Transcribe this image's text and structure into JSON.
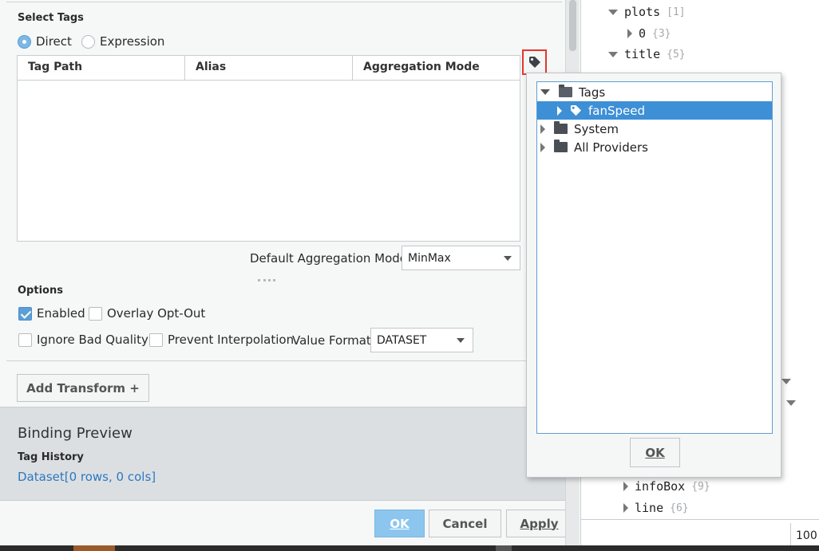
{
  "dialog": {
    "select_tags_label": "Select Tags",
    "source_mode": {
      "direct": "Direct",
      "expression": "Expression",
      "selected": "Direct"
    },
    "table_columns": [
      "Tag Path",
      "Alias",
      "Aggregation Mode"
    ],
    "default_aggregation_label": "Default Aggregation Mode",
    "default_aggregation_value": "MinMax",
    "options_label": "Options",
    "options": {
      "enabled": {
        "label": "Enabled",
        "checked": true
      },
      "overlay_opt_out": {
        "label": "Overlay Opt-Out",
        "checked": false
      },
      "ignore_bad_quality": {
        "label": "Ignore Bad Quality",
        "checked": false
      },
      "prevent_interpolation": {
        "label": "Prevent Interpolation",
        "checked": false
      }
    },
    "value_format_label": "Value Format",
    "value_format_value": "DATASET",
    "add_transform_label": "Add Transform +",
    "preview": {
      "title": "Binding Preview",
      "subtitle": "Tag History",
      "value": "Dataset[0 rows, 0 cols]"
    },
    "buttons": {
      "ok": "OK",
      "cancel": "Cancel",
      "apply": "Apply"
    }
  },
  "tag_browser": {
    "tree": [
      {
        "label": "Tags",
        "icon": "folder-open-icon",
        "expanded": true
      },
      {
        "label": "fanSpeed",
        "icon": "tag-icon",
        "selected": true
      },
      {
        "label": "System",
        "icon": "folder-icon",
        "expanded": false
      },
      {
        "label": "All Providers",
        "icon": "folder-icon",
        "expanded": false
      }
    ],
    "ok_label": "OK"
  },
  "property_tree": {
    "rows": [
      {
        "key": "plots",
        "count": "[1]"
      },
      {
        "key": "0",
        "count": "{3}"
      },
      {
        "key": "title",
        "count": "{5}"
      },
      {
        "key": "infoBox",
        "count": "{9}"
      },
      {
        "key": "line",
        "count": "{6}"
      }
    ],
    "zoom_fragment": "100"
  },
  "colors": {
    "accent": "#3d8fd6",
    "highlight_border": "#e2372f",
    "link": "#2d78c0"
  }
}
